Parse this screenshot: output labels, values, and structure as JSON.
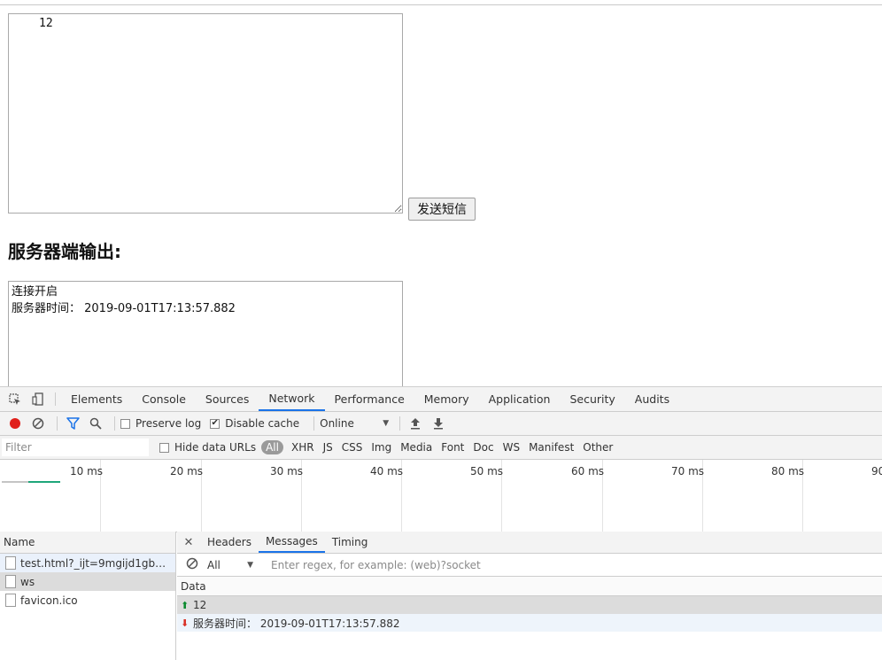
{
  "page": {
    "message_input_value": "12",
    "send_button_label": "发送短信",
    "server_heading": "服务器端输出:",
    "server_output_lines": [
      "连接开启",
      "服务器时间： 2019-09-01T17:13:57.882"
    ]
  },
  "devtools": {
    "tabs": [
      "Elements",
      "Console",
      "Sources",
      "Network",
      "Performance",
      "Memory",
      "Application",
      "Security",
      "Audits"
    ],
    "active_tab": "Network",
    "toolbar": {
      "preserve_log": "Preserve log",
      "disable_cache": "Disable cache",
      "throttling": "Online",
      "disable_cache_checked": true,
      "preserve_log_checked": false
    },
    "filter": {
      "placeholder": "Filter",
      "hide_data_urls": "Hide data URLs",
      "types": [
        "All",
        "XHR",
        "JS",
        "CSS",
        "Img",
        "Media",
        "Font",
        "Doc",
        "WS",
        "Manifest",
        "Other"
      ]
    },
    "timeline_ticks": [
      "10 ms",
      "20 ms",
      "30 ms",
      "40 ms",
      "50 ms",
      "60 ms",
      "70 ms",
      "80 ms",
      "90"
    ],
    "requests": {
      "header": "Name",
      "items": [
        "test.html?_ijt=9mgijd1gbc27g...",
        "ws",
        "favicon.ico"
      ]
    },
    "detail_tabs": [
      "Headers",
      "Messages",
      "Timing"
    ],
    "active_detail_tab": "Messages",
    "messages": {
      "filter_select": "All",
      "regex_placeholder": "Enter regex, for example: (web)?socket",
      "data_header": "Data",
      "frames": [
        {
          "direction": "sent",
          "text": "12"
        },
        {
          "direction": "received",
          "text": "服务器时间：  2019-09-01T17:13:57.882"
        }
      ]
    },
    "colors": {
      "accent": "#1a73e8",
      "record": "#e0201b",
      "filter_icon": "#1a73e8",
      "sent_arrow": "#0a8a2e",
      "received_arrow": "#d93025"
    }
  }
}
